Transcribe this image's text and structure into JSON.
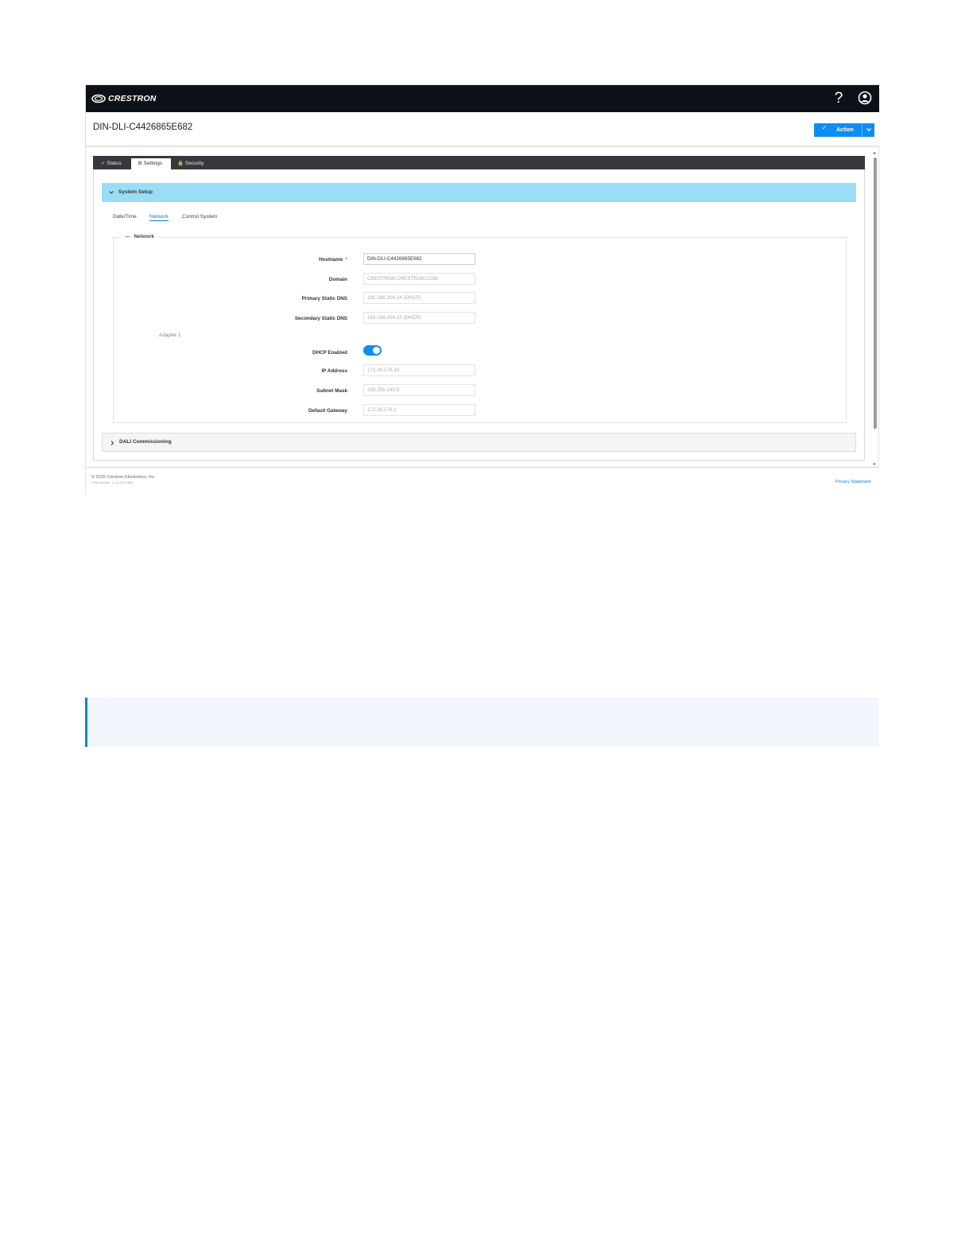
{
  "header": {
    "brand": "CRESTRON",
    "help_icon": "question-mark-icon",
    "user_icon": "user-circle-icon"
  },
  "titlebar": {
    "device_name": "DIN-DLI-C4426865E682",
    "action_label": "Action"
  },
  "tabs": [
    {
      "label": "Status",
      "icon": "check-icon"
    },
    {
      "label": "Settings",
      "icon": "gear-icon",
      "active": true
    },
    {
      "label": "Security",
      "icon": "lock-icon"
    }
  ],
  "system_setup": {
    "title": "System Setup",
    "subtabs": [
      "Date/Time",
      "Network",
      "Control System"
    ],
    "active_subtab": "Network",
    "network": {
      "legend": "Network",
      "hostname": {
        "label": "Hostname",
        "required_mark": "*",
        "value": "DIN-DLI-C4426865E682"
      },
      "domain": {
        "label": "Domain",
        "value": "CRESTRON.CRESTRON.COM"
      },
      "primary_dns": {
        "label": "Primary Static DNS",
        "value": "192.168.204.24 (DHCP)"
      },
      "secondary_dns": {
        "label": "Secondary Static DNS",
        "value": "192.168.204.23 (DHCP)"
      },
      "adapter_label": "Adapter 1",
      "dhcp": {
        "label": "DHCP Enabled",
        "enabled": true
      },
      "ip_address": {
        "label": "IP Address",
        "value": "172.30.176.33"
      },
      "subnet_mask": {
        "label": "Subnet Mask",
        "value": "255.255.240.0"
      },
      "gateway": {
        "label": "Default Gateway",
        "value": "172.30.176.1"
      }
    }
  },
  "dali": {
    "title": "DALI Commissioning"
  },
  "footer": {
    "copyright": "© 2025 Crestron Electronics, Inc.",
    "version": "CEM Version: 1.1.8.0.917304",
    "privacy": "Privacy Statement"
  },
  "colors": {
    "topbar": "#0c1117",
    "accent": "#0d8ef2",
    "accordion": "#99ddf6",
    "note_border": "#0e8ab8"
  }
}
